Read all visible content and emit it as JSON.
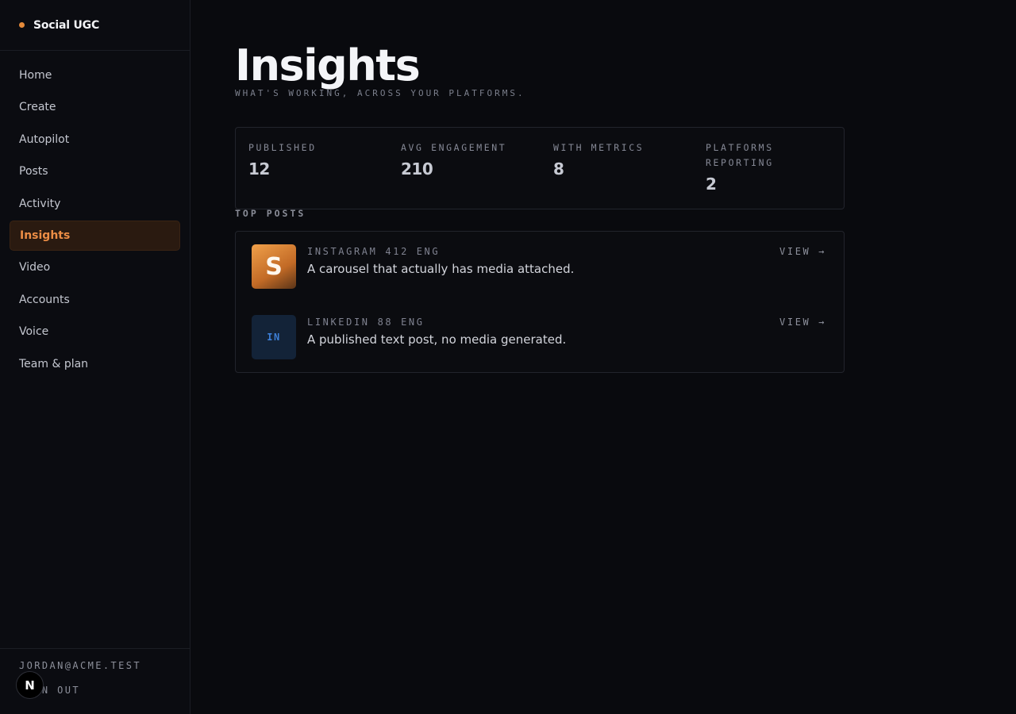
{
  "app": {
    "brand_name": "Social UGC",
    "brand_dot_color": "#e58a3a"
  },
  "sidebar": {
    "items": [
      {
        "label": "Home"
      },
      {
        "label": "Create"
      },
      {
        "label": "Autopilot"
      },
      {
        "label": "Posts"
      },
      {
        "label": "Activity"
      },
      {
        "label": "Insights",
        "active": true
      },
      {
        "label": "Video"
      },
      {
        "label": "Accounts"
      },
      {
        "label": "Voice"
      },
      {
        "label": "Team & plan"
      }
    ],
    "user_email": "JORDAN@ACME.TEST",
    "sign_out_label": "SIGN OUT",
    "badge_letter": "N"
  },
  "page": {
    "title": "Insights",
    "subtitle": "WHAT'S WORKING, ACROSS YOUR PLATFORMS."
  },
  "stats": [
    {
      "label": "PUBLISHED",
      "value": "12"
    },
    {
      "label": "AVG ENGAGEMENT",
      "value": "210"
    },
    {
      "label": "WITH METRICS",
      "value": "8"
    },
    {
      "label": "PLATFORMS REPORTING",
      "value": "2"
    }
  ],
  "top_posts": {
    "title": "TOP POSTS",
    "items": [
      {
        "platform": "INSTAGRAM",
        "engagement": "412 ENG",
        "text": "A carousel that actually has media attached.",
        "thumb_glyph": "S",
        "view_label": "VIEW →"
      },
      {
        "platform": "LINKEDIN",
        "engagement": "88 ENG",
        "text": "A published text post, no media generated.",
        "thumb_glyph": "IN",
        "view_label": "VIEW →"
      }
    ]
  },
  "colors": {
    "accent": "#ec8d45",
    "background": "#090a0e",
    "active_nav_bg": "#2a1a10"
  }
}
